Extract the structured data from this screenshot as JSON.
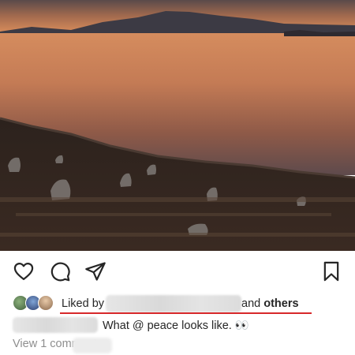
{
  "post": {
    "liked_by_prefix": "Liked by",
    "liked_by_suffix_and": "and",
    "liked_by_suffix_others": "others",
    "caption": "What @ peace looks like. 👀",
    "view_comments": "View 1 comment"
  },
  "icons": {
    "like": "heart-icon",
    "comment": "comment-bubble-icon",
    "share": "paper-plane-icon",
    "save": "bookmark-icon"
  },
  "colors": {
    "text": "#262626",
    "muted": "#8e8e8e",
    "highlight_underline": "#d7282a"
  }
}
